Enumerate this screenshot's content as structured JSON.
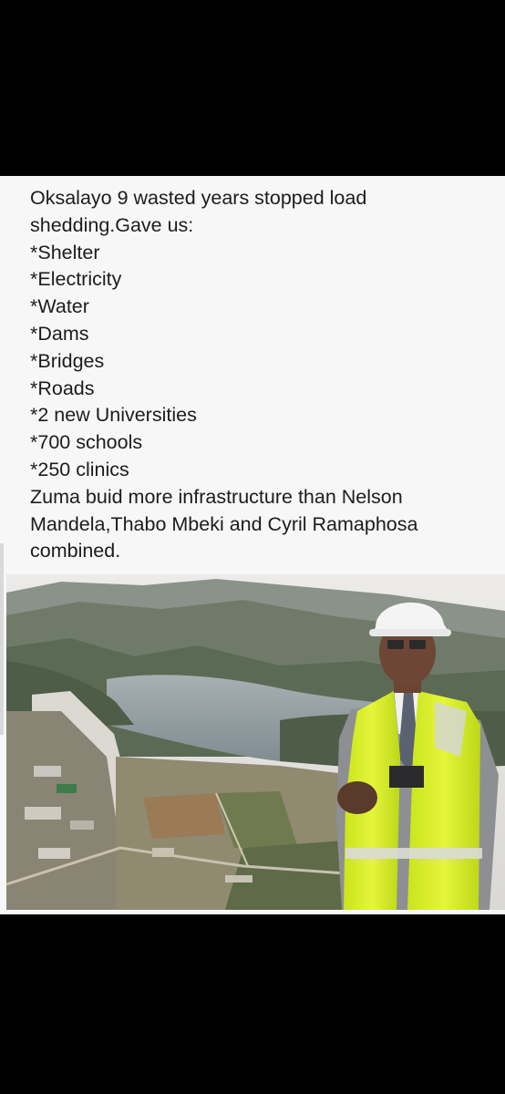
{
  "post": {
    "lines": [
      "Oksalayo 9 wasted years stopped load",
      "shedding.Gave us:",
      "*Shelter",
      "*Electricity",
      "*Water",
      "*Dams",
      "*Bridges",
      "*Roads",
      "*2 new Universities",
      "*700 schools",
      "*250 clinics",
      "Zuma buid more infrastructure than Nelson",
      "Mandela,Thabo Mbeki and Cyril Ramaphosa",
      "combined."
    ]
  },
  "photo": {
    "description_icon": "dam-photo",
    "colors": {
      "sky": "#e6e3e0",
      "hills": "#6e7a67",
      "water": "#8e9aa0",
      "vest": "#d8f02a",
      "suit": "#8e8f92",
      "helmet": "#f4f4f4"
    }
  }
}
